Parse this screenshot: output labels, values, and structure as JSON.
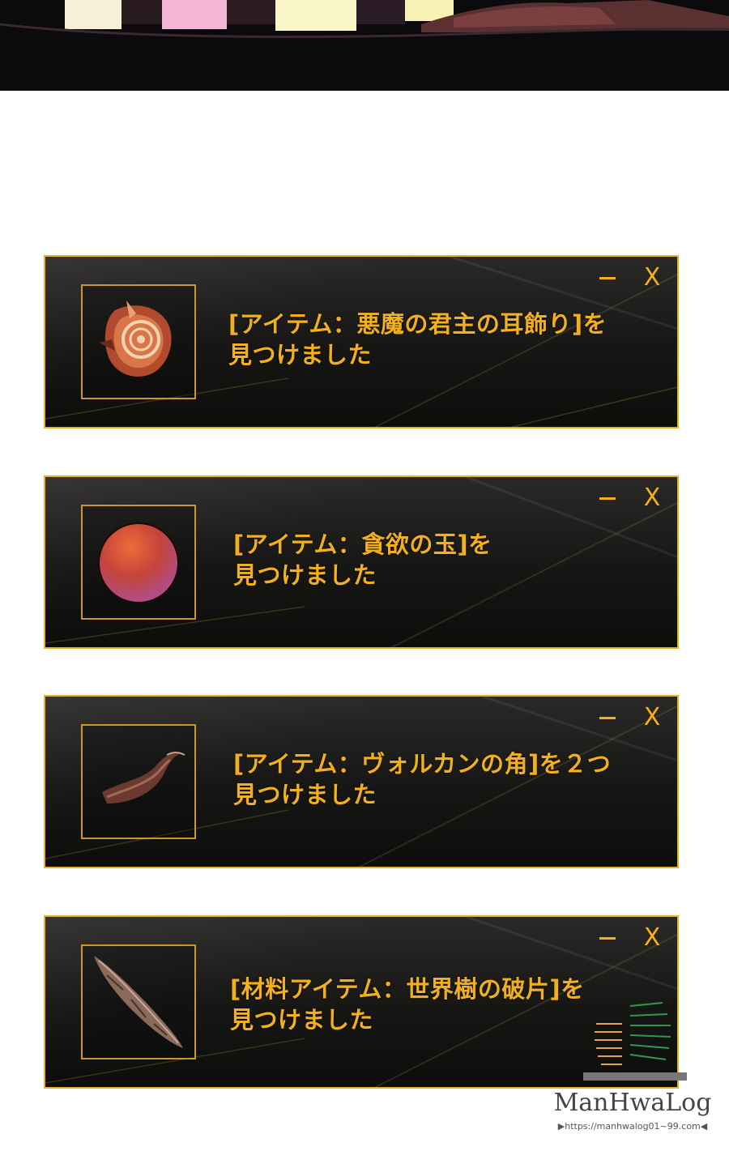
{
  "cards": [
    {
      "item_icon": "demon-earring-icon",
      "line1": "[アイテム：悪魔の君主の耳飾り]を",
      "line2": "見つけました",
      "minimize_label": "",
      "close_label": "X"
    },
    {
      "item_icon": "orb-of-greed-icon",
      "line1": "[アイテム：貪欲の玉]を",
      "line2": "見つけました",
      "minimize_label": "",
      "close_label": "X"
    },
    {
      "item_icon": "vulcan-horn-icon",
      "line1": "[アイテム：ヴォルカンの角]を２つ",
      "line2": "見つけました",
      "minimize_label": "",
      "close_label": "X"
    },
    {
      "item_icon": "world-tree-fragment-icon",
      "line1": "[材料アイテム：世界樹の破片]を",
      "line2": "見つけました",
      "minimize_label": "",
      "close_label": "X"
    }
  ],
  "watermark": {
    "logo": "ManHwaLog",
    "url": "▶https://manhwalog01~99.com◀"
  },
  "colors": {
    "accent": "#f2b01e",
    "border": "#e3b22a",
    "panel": "#161614"
  }
}
